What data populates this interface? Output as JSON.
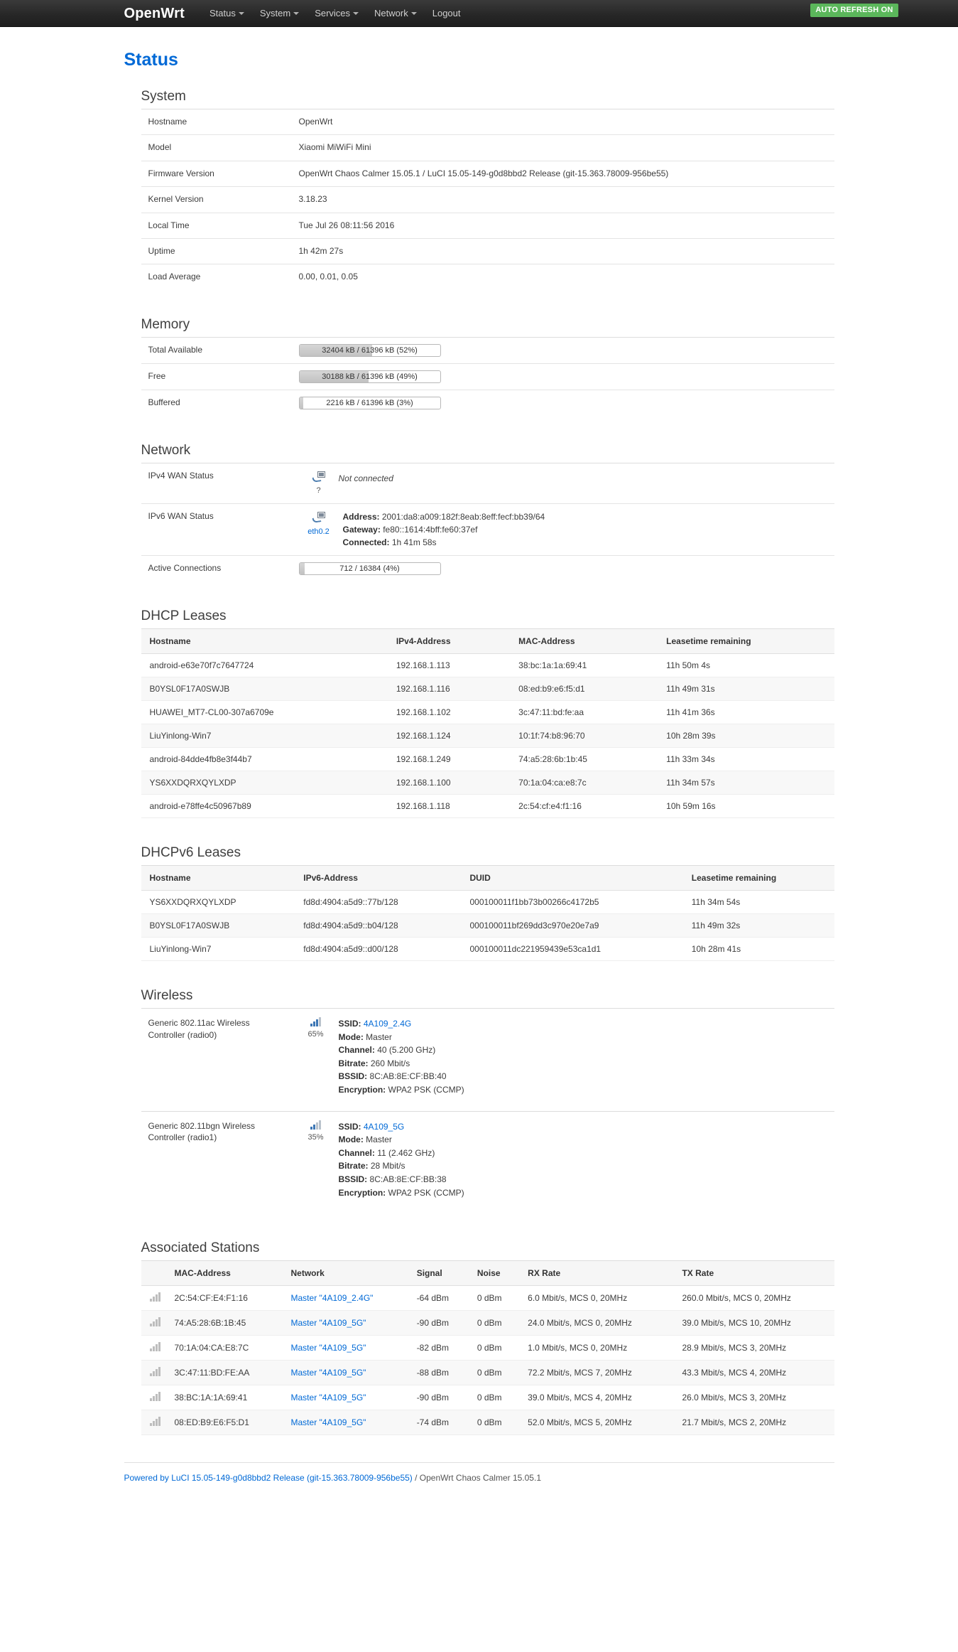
{
  "nav": {
    "brand": "OpenWrt",
    "items": [
      {
        "label": "Status",
        "caret": true
      },
      {
        "label": "System",
        "caret": true
      },
      {
        "label": "Services",
        "caret": true
      },
      {
        "label": "Network",
        "caret": true
      },
      {
        "label": "Logout",
        "caret": false
      }
    ],
    "refresh_badge": "AUTO REFRESH ON",
    "refresh_color": "#5bb75b"
  },
  "page": {
    "title": "Status"
  },
  "system": {
    "title": "System",
    "rows": [
      {
        "key": "Hostname",
        "value": "OpenWrt"
      },
      {
        "key": "Model",
        "value": "Xiaomi MiWiFi Mini"
      },
      {
        "key": "Firmware Version",
        "value": "OpenWrt Chaos Calmer 15.05.1 / LuCI 15.05-149-g0d8bbd2 Release (git-15.363.78009-956be55)"
      },
      {
        "key": "Kernel Version",
        "value": "3.18.23"
      },
      {
        "key": "Local Time",
        "value": "Tue Jul 26 08:11:56 2016"
      },
      {
        "key": "Uptime",
        "value": "1h 42m 27s"
      },
      {
        "key": "Load Average",
        "value": "0.00, 0.01, 0.05"
      }
    ]
  },
  "memory": {
    "title": "Memory",
    "rows": [
      {
        "key": "Total Available",
        "text": "32404 kB / 61396 kB (52%)",
        "percent": 52
      },
      {
        "key": "Free",
        "text": "30188 kB / 61396 kB (49%)",
        "percent": 49
      },
      {
        "key": "Buffered",
        "text": "2216 kB / 61396 kB (3%)",
        "percent": 3
      }
    ]
  },
  "network": {
    "title": "Network",
    "ipv4": {
      "key": "IPv4 WAN Status",
      "iface_label": "?",
      "status": "Not connected"
    },
    "ipv6": {
      "key": "IPv6 WAN Status",
      "iface_label": "eth0.2",
      "address_label": "Address:",
      "address": "2001:da8:a009:182f:8eab:8eff:fecf:bb39/64",
      "gateway_label": "Gateway:",
      "gateway": "fe80::1614:4bff:fe60:37ef",
      "connected_label": "Connected:",
      "connected": "1h 41m 58s"
    },
    "active_connections": {
      "key": "Active Connections",
      "text": "712 / 16384 (4%)",
      "percent": 4
    }
  },
  "dhcp_leases": {
    "title": "DHCP Leases",
    "columns": [
      "Hostname",
      "IPv4-Address",
      "MAC-Address",
      "Leasetime remaining"
    ],
    "rows": [
      [
        "android-e63e70f7c7647724",
        "192.168.1.113",
        "38:bc:1a:1a:69:41",
        "11h 50m 4s"
      ],
      [
        "B0YSL0F17A0SWJB",
        "192.168.1.116",
        "08:ed:b9:e6:f5:d1",
        "11h 49m 31s"
      ],
      [
        "HUAWEI_MT7-CL00-307a6709e",
        "192.168.1.102",
        "3c:47:11:bd:fe:aa",
        "11h 41m 36s"
      ],
      [
        "LiuYinlong-Win7",
        "192.168.1.124",
        "10:1f:74:b8:96:70",
        "10h 28m 39s"
      ],
      [
        "android-84dde4fb8e3f44b7",
        "192.168.1.249",
        "74:a5:28:6b:1b:45",
        "11h 33m 34s"
      ],
      [
        "YS6XXDQRXQYLXDP",
        "192.168.1.100",
        "70:1a:04:ca:e8:7c",
        "11h 34m 57s"
      ],
      [
        "android-e78ffe4c50967b89",
        "192.168.1.118",
        "2c:54:cf:e4:f1:16",
        "10h 59m 16s"
      ]
    ]
  },
  "dhcpv6_leases": {
    "title": "DHCPv6 Leases",
    "columns": [
      "Hostname",
      "IPv6-Address",
      "DUID",
      "Leasetime remaining"
    ],
    "rows": [
      [
        "YS6XXDQRXQYLXDP",
        "fd8d:4904:a5d9::77b/128",
        "000100011f1bb73b00266c4172b5",
        "11h 34m 54s"
      ],
      [
        "B0YSL0F17A0SWJB",
        "fd8d:4904:a5d9::b04/128",
        "000100011bf269dd3c970e20e7a9",
        "11h 49m 32s"
      ],
      [
        "LiuYinlong-Win7",
        "fd8d:4904:a5d9::d00/128",
        "000100011dc221959439e53ca1d1",
        "10h 28m 41s"
      ]
    ]
  },
  "wireless": {
    "title": "Wireless",
    "radios": [
      {
        "name": "Generic 802.11ac Wireless Controller (radio0)",
        "signal_percent": "65%",
        "bars_on": 3,
        "ssid_label": "SSID:",
        "ssid": "4A109_2.4G",
        "mode_label": "Mode:",
        "mode": "Master",
        "channel_label": "Channel:",
        "channel": "40 (5.200 GHz)",
        "bitrate_label": "Bitrate:",
        "bitrate": "260 Mbit/s",
        "bssid_label": "BSSID:",
        "bssid": "8C:AB:8E:CF:BB:40",
        "encryption_label": "Encryption:",
        "encryption": "WPA2 PSK (CCMP)"
      },
      {
        "name": "Generic 802.11bgn Wireless Controller (radio1)",
        "signal_percent": "35%",
        "bars_on": 2,
        "ssid_label": "SSID:",
        "ssid": "4A109_5G",
        "mode_label": "Mode:",
        "mode": "Master",
        "channel_label": "Channel:",
        "channel": "11 (2.462 GHz)",
        "bitrate_label": "Bitrate:",
        "bitrate": "28 Mbit/s",
        "bssid_label": "BSSID:",
        "bssid": "8C:AB:8E:CF:BB:38",
        "encryption_label": "Encryption:",
        "encryption": "WPA2 PSK (CCMP)"
      }
    ]
  },
  "associated_stations": {
    "title": "Associated Stations",
    "columns": [
      "",
      "MAC-Address",
      "Network",
      "Signal",
      "Noise",
      "RX Rate",
      "TX Rate"
    ],
    "rows": [
      {
        "mac": "2C:54:CF:E4:F1:16",
        "network": "Master \"4A109_2.4G\"",
        "signal": "-64 dBm",
        "noise": "0 dBm",
        "rx": "6.0 Mbit/s, MCS 0, 20MHz",
        "tx": "260.0 Mbit/s, MCS 0, 20MHz"
      },
      {
        "mac": "74:A5:28:6B:1B:45",
        "network": "Master \"4A109_5G\"",
        "signal": "-90 dBm",
        "noise": "0 dBm",
        "rx": "24.0 Mbit/s, MCS 0, 20MHz",
        "tx": "39.0 Mbit/s, MCS 10, 20MHz"
      },
      {
        "mac": "70:1A:04:CA:E8:7C",
        "network": "Master \"4A109_5G\"",
        "signal": "-82 dBm",
        "noise": "0 dBm",
        "rx": "1.0 Mbit/s, MCS 0, 20MHz",
        "tx": "28.9 Mbit/s, MCS 3, 20MHz"
      },
      {
        "mac": "3C:47:11:BD:FE:AA",
        "network": "Master \"4A109_5G\"",
        "signal": "-88 dBm",
        "noise": "0 dBm",
        "rx": "72.2 Mbit/s, MCS 7, 20MHz",
        "tx": "43.3 Mbit/s, MCS 4, 20MHz"
      },
      {
        "mac": "38:BC:1A:1A:69:41",
        "network": "Master \"4A109_5G\"",
        "signal": "-90 dBm",
        "noise": "0 dBm",
        "rx": "39.0 Mbit/s, MCS 4, 20MHz",
        "tx": "26.0 Mbit/s, MCS 3, 20MHz"
      },
      {
        "mac": "08:ED:B9:E6:F5:D1",
        "network": "Master \"4A109_5G\"",
        "signal": "-74 dBm",
        "noise": "0 dBm",
        "rx": "52.0 Mbit/s, MCS 5, 20MHz",
        "tx": "21.7 Mbit/s, MCS 2, 20MHz"
      }
    ]
  },
  "footer": {
    "link_text": "Powered by LuCI 15.05-149-g0d8bbd2 Release (git-15.363.78009-956be55)",
    "suffix": " / OpenWrt Chaos Calmer 15.05.1"
  }
}
